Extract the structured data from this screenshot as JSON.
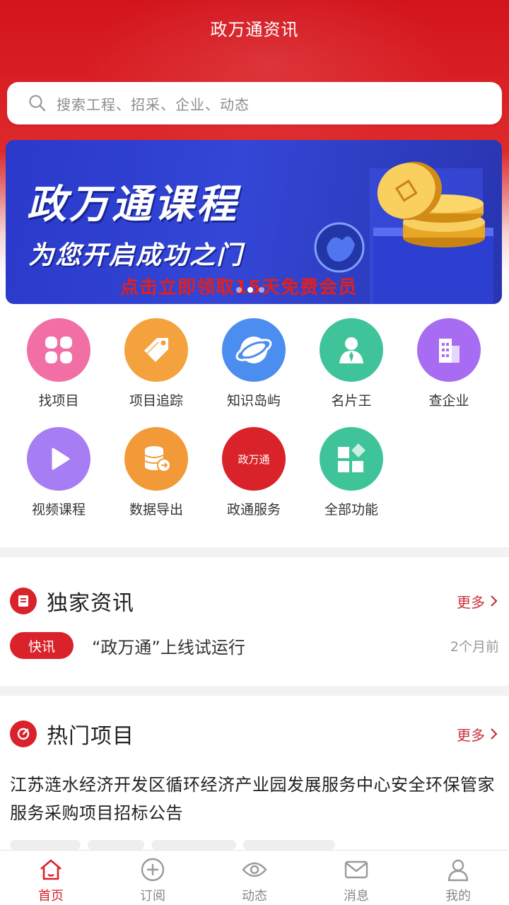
{
  "header": {
    "title": "政万通资讯",
    "search_placeholder": "搜索工程、招采、企业、动态"
  },
  "banner": {
    "title": "政万通课程",
    "subtitle": "为您开启成功之门",
    "cta": "点击立即领取15天免费会员",
    "slide_count": 3,
    "active_slide": 2
  },
  "grid": {
    "items": [
      {
        "label": "找项目",
        "icon": "clover-icon",
        "color": "#f16fa5"
      },
      {
        "label": "项目追踪",
        "icon": "tag-icon",
        "color": "#f3a23d"
      },
      {
        "label": "知识岛屿",
        "icon": "globe-icon",
        "color": "#4c8df0"
      },
      {
        "label": "名片王",
        "icon": "person-icon",
        "color": "#3fc49a"
      },
      {
        "label": "查企业",
        "icon": "building-icon",
        "color": "#a76cf2"
      },
      {
        "label": "视频课程",
        "icon": "play-icon",
        "color": "#a77df3"
      },
      {
        "label": "数据导出",
        "icon": "database-icon",
        "color": "#f39a38"
      },
      {
        "label": "政通服务",
        "icon": "zwt-logo-icon",
        "color": "#d9222a",
        "logo_text": "政万通"
      },
      {
        "label": "全部功能",
        "icon": "apps-icon",
        "color": "#3fc49a"
      }
    ]
  },
  "exclusive_news": {
    "title": "独家资讯",
    "more": "更多",
    "item": {
      "tag": "快讯",
      "title": "“政万通”上线试运行",
      "time": "2个月前"
    }
  },
  "hot_projects": {
    "title": "热门项目",
    "more": "更多",
    "item_title": "江苏涟水经济开发区循环经济产业园发展服务中心安全环保管家服务采购项目招标公告"
  },
  "tabbar": {
    "items": [
      {
        "label": "首页",
        "icon": "home-icon",
        "active": true
      },
      {
        "label": "订阅",
        "icon": "plus-circle-icon",
        "active": false
      },
      {
        "label": "动态",
        "icon": "eye-icon",
        "active": false
      },
      {
        "label": "消息",
        "icon": "mail-icon",
        "active": false
      },
      {
        "label": "我的",
        "icon": "user-icon",
        "active": false
      }
    ]
  },
  "colors": {
    "brand_red": "#d9222a",
    "banner_blue": "#3346d6"
  }
}
